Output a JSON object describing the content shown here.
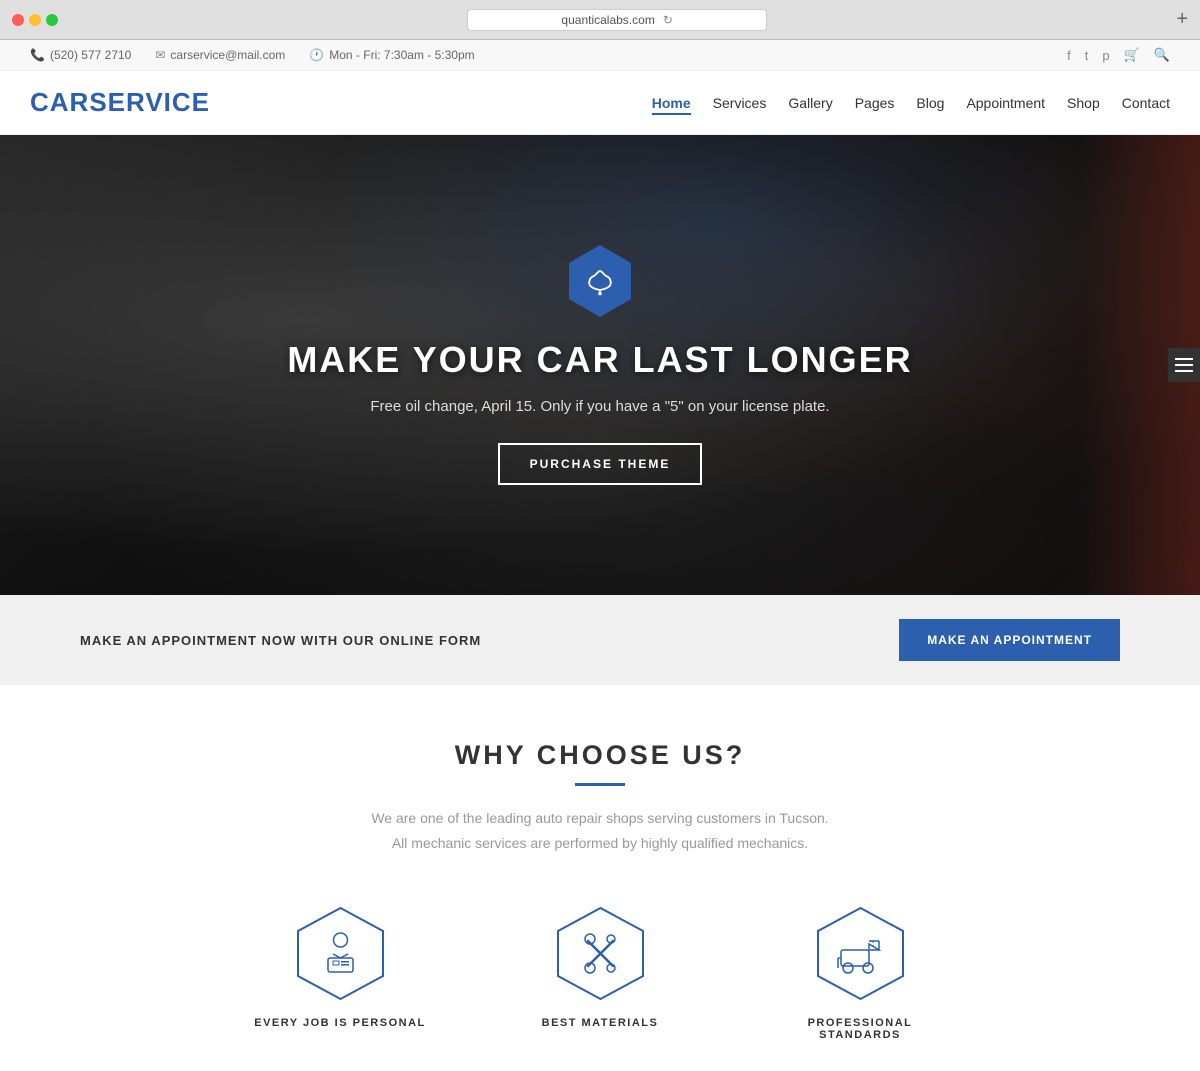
{
  "browser": {
    "url": "quanticalabs.com",
    "reload_icon": "↻"
  },
  "topbar": {
    "phone": "(520) 577 2710",
    "email": "carservice@mail.com",
    "hours": "Mon - Fri: 7:30am - 5:30pm"
  },
  "nav": {
    "logo": "CARSERVICE",
    "links": [
      {
        "label": "Home",
        "active": true
      },
      {
        "label": "Services",
        "active": false
      },
      {
        "label": "Gallery",
        "active": false
      },
      {
        "label": "Pages",
        "active": false
      },
      {
        "label": "Blog",
        "active": false
      },
      {
        "label": "Appointment",
        "active": false
      },
      {
        "label": "Shop",
        "active": false
      },
      {
        "label": "Contact",
        "active": false
      }
    ]
  },
  "hero": {
    "title": "MAKE YOUR CAR LAST LONGER",
    "subtitle": "Free oil change, April 15. Only if you have a \"5\" on your license plate.",
    "button_label": "PURCHASE THEME"
  },
  "appointment_bar": {
    "text": "MAKE AN APPOINTMENT NOW WITH OUR ONLINE FORM",
    "button_label": "MAKE AN APPOINTMENT"
  },
  "why_section": {
    "title": "WHY CHOOSE US?",
    "subtitle_line1": "We are one of the leading auto repair shops serving customers in Tucson.",
    "subtitle_line2": "All mechanic services are performed by highly qualified mechanics.",
    "features": [
      {
        "label": "EVERY JOB IS PERSONAL"
      },
      {
        "label": "BEST MATERIALS"
      },
      {
        "label": "PROFESSIONAL STANDARDS"
      }
    ]
  }
}
